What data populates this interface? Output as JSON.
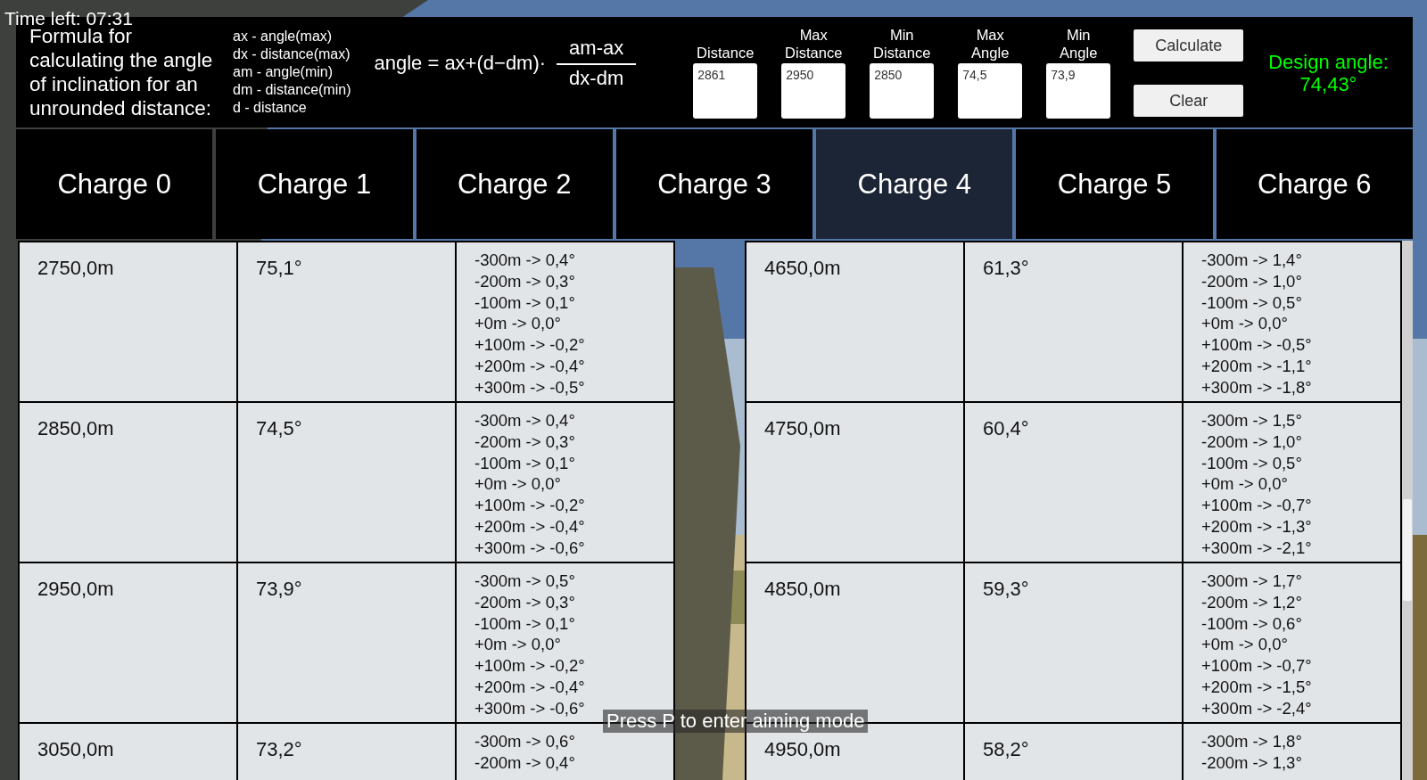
{
  "timer": "Time left: 07:31",
  "formula": {
    "description": "Formula for calculating the angle of inclination for an unrounded distance:",
    "legend": [
      "ax - angle(max)",
      "dx - distance(max)",
      "am - angle(min)",
      "dm - distance(min)",
      "d - distance"
    ],
    "equation": "angle = ax+(d−dm)·",
    "numerator": "am-ax",
    "denominator": "dx-dm"
  },
  "fields": [
    {
      "label": "Distance",
      "value": "2861"
    },
    {
      "label": "Max Distance",
      "value": "2950"
    },
    {
      "label": "Min Distance",
      "value": "2850"
    },
    {
      "label": "Max Angle",
      "value": "74,5"
    },
    {
      "label": "Min Angle",
      "value": "73,9"
    }
  ],
  "buttons": [
    "Calculate",
    "Clear"
  ],
  "result": {
    "label": "Design angle:",
    "value": "74,43°"
  },
  "tabs": [
    {
      "label": "Charge 0",
      "selected": false
    },
    {
      "label": "Charge 1",
      "selected": false
    },
    {
      "label": "Charge 2",
      "selected": false
    },
    {
      "label": "Charge 3",
      "selected": false
    },
    {
      "label": "Charge 4",
      "selected": true
    },
    {
      "label": "Charge 5",
      "selected": false
    },
    {
      "label": "Charge 6",
      "selected": false
    }
  ],
  "table": {
    "rows": [
      {
        "left": {
          "distance": "2750,0m",
          "angle": "75,1°",
          "corrections": [
            "-300m -> 0,4°",
            "-200m -> 0,3°",
            "-100m -> 0,1°",
            "+0m -> 0,0°",
            "+100m -> -0,2°",
            "+200m -> -0,4°",
            "+300m -> -0,5°"
          ]
        },
        "right": {
          "distance": "4650,0m",
          "angle": "61,3°",
          "corrections": [
            "-300m -> 1,4°",
            "-200m -> 1,0°",
            "-100m -> 0,5°",
            "+0m -> 0,0°",
            "+100m -> -0,5°",
            "+200m -> -1,1°",
            "+300m -> -1,8°"
          ]
        }
      },
      {
        "left": {
          "distance": "2850,0m",
          "angle": "74,5°",
          "corrections": [
            "-300m -> 0,4°",
            "-200m -> 0,3°",
            "-100m -> 0,1°",
            "+0m -> 0,0°",
            "+100m -> -0,2°",
            "+200m -> -0,4°",
            "+300m -> -0,6°"
          ]
        },
        "right": {
          "distance": "4750,0m",
          "angle": "60,4°",
          "corrections": [
            "-300m -> 1,5°",
            "-200m -> 1,0°",
            "-100m -> 0,5°",
            "+0m -> 0,0°",
            "+100m -> -0,7°",
            "+200m -> -1,3°",
            "+300m -> -2,1°"
          ]
        }
      },
      {
        "left": {
          "distance": "2950,0m",
          "angle": "73,9°",
          "corrections": [
            "-300m -> 0,5°",
            "-200m -> 0,3°",
            "-100m -> 0,1°",
            "+0m -> 0,0°",
            "+100m -> -0,2°",
            "+200m -> -0,4°",
            "+300m -> -0,6°"
          ]
        },
        "right": {
          "distance": "4850,0m",
          "angle": "59,3°",
          "corrections": [
            "-300m -> 1,7°",
            "-200m -> 1,2°",
            "-100m -> 0,6°",
            "+0m -> 0,0°",
            "+100m -> -0,7°",
            "+200m -> -1,5°",
            "+300m -> -2,4°"
          ]
        }
      },
      {
        "left": {
          "distance": "3050,0m",
          "angle": "73,2°",
          "corrections": [
            "-300m -> 0,6°",
            "-200m -> 0,4°"
          ]
        },
        "right": {
          "distance": "4950,0m",
          "angle": "58,2°",
          "corrections": [
            "-300m -> 1,8°",
            "-200m -> 1,3°"
          ]
        }
      }
    ]
  },
  "hint": "Press P to enter aiming mode"
}
